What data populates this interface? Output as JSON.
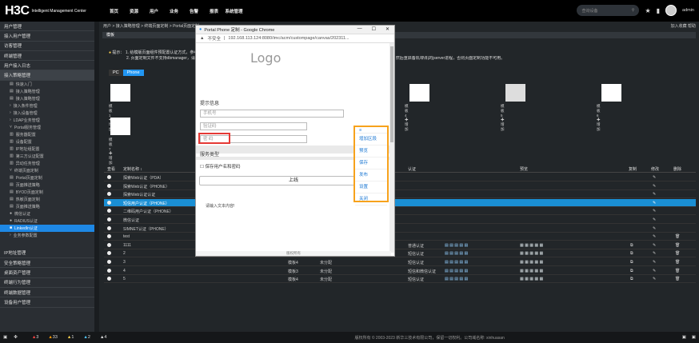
{
  "app": {
    "logo_main": "H3C",
    "logo_sub": "Intelligent Management Center",
    "menu": [
      "首页",
      "资源",
      "用户",
      "业务",
      "告警",
      "报表",
      "系统管理"
    ],
    "search_placeholder": "查询设备",
    "user": "admin"
  },
  "sidebar": {
    "items": [
      {
        "label": "用户管理"
      },
      {
        "label": "接入用户管理"
      },
      {
        "label": "访客管理"
      },
      {
        "label": "终端管理"
      },
      {
        "label": "用户接入日志"
      },
      {
        "label": "接入策略管理"
      }
    ],
    "subs": [
      {
        "label": "快速入门"
      },
      {
        "label": "接入策略管理"
      },
      {
        "label": "接入策略管理"
      },
      {
        "label": "接入条件管理"
      },
      {
        "label": "接入设备管理"
      },
      {
        "label": "LDAP业务管理"
      },
      {
        "label": "Portal服务管理"
      },
      {
        "label": "服务器配置"
      },
      {
        "label": "设备配置"
      },
      {
        "label": "IP地址组配置"
      },
      {
        "label": "第三方认证配置"
      },
      {
        "label": "异动任务管理"
      },
      {
        "label": "终端页面定制"
      },
      {
        "label": "Portal页面定制"
      },
      {
        "label": "页面推送策略"
      },
      {
        "label": "BYOD页面定制"
      },
      {
        "label": "热敏页面定制"
      },
      {
        "label": "页面推送策略"
      },
      {
        "label": "微信认证"
      },
      {
        "label": "RADIUS认证"
      },
      {
        "label": "LinkedIn认证"
      },
      {
        "label": "业务参数配置"
      }
    ],
    "bottom_items": [
      {
        "label": "IP地址管理"
      },
      {
        "label": "安全策略管理"
      },
      {
        "label": "桌面资产管理"
      },
      {
        "label": "终端行为管理"
      },
      {
        "label": "终端数据管理"
      },
      {
        "label": "设备用户管理"
      }
    ]
  },
  "main": {
    "breadcrumb": "用户 > 接入策略管理 > 终端页面定制 > Portal页面定制",
    "favorites": "加入收藏 帮助",
    "panel_title": "模板",
    "tip_label": "提示：",
    "tip_line1": "1. 给模版页面组件预配置认证方式，参考用户管理员配置说明，对应的方式才能使用。",
    "tip_line2": "2. 页面定制文件不支持dbmanager，请将定制文件在imc\\client\\web\\apps\\imc\\acm\\custompage\\canvas目录下的所有文件拷贝到备机/新机的相应目录下，然后重启备机/新机的jserver进程，否则页面定制功能不可用。",
    "tabs": [
      "PC",
      "Phone"
    ],
    "thumbs": [
      {
        "label": "模板1"
      },
      {
        "label": "模板7"
      },
      {
        "label": "模板4"
      },
      {
        "label": "模板5"
      },
      {
        "label": "模板6"
      }
    ],
    "add_label": "增加",
    "columns": [
      "查看",
      "定制名称 ↕",
      "终端",
      "状态",
      "认证",
      "预览",
      "复制",
      "修改",
      "删除"
    ],
    "rows": [
      {
        "name": "探索Web认证（PDA）",
        "type": "",
        "state": "",
        "auth": "",
        "selected": false
      },
      {
        "name": "探索Web认证（PHONE）",
        "type": "",
        "state": "",
        "auth": "",
        "selected": false
      },
      {
        "name": "探索Web认证认证",
        "type": "",
        "state": "",
        "auth": "",
        "selected": false
      },
      {
        "name": "短信用户认证（PHONE）",
        "type": "",
        "state": "",
        "auth": "",
        "selected": true
      },
      {
        "name": "二维码用户认证（PHONE）",
        "type": "",
        "state": "",
        "auth": "",
        "selected": false
      },
      {
        "name": "微信认证",
        "type": "",
        "state": "",
        "auth": "",
        "selected": false
      },
      {
        "name": "SIMNET认证（PHONE）",
        "type": "",
        "state": "",
        "auth": "",
        "selected": false
      },
      {
        "name": "test",
        "type": "",
        "state": "",
        "auth": "",
        "selected": false
      },
      {
        "name": "1111",
        "type": "模板1",
        "state": "未分配",
        "auth": "普通认证",
        "selected": false
      },
      {
        "name": "2",
        "type": "模板1",
        "state": "未分配",
        "auth": "短信认证",
        "selected": false
      },
      {
        "name": "3",
        "type": "模板4",
        "state": "未分配",
        "auth": "短信认证",
        "selected": false
      },
      {
        "name": "4",
        "type": "模板3",
        "state": "未分配",
        "auth": "短信和微信认证",
        "selected": false
      },
      {
        "name": "5",
        "type": "模板4",
        "state": "未分配",
        "auth": "短信认证",
        "selected": false
      }
    ]
  },
  "popup": {
    "title": "Portal Phone 定制 - Google Chrome",
    "security": "不安全",
    "address": "192.168.113.124:8080/imc/acm/custompage/canvas/202311...",
    "logo": "Logo",
    "section_info": "提示信息",
    "phone_ph": "手机号",
    "code_ph": "验证码",
    "pwd_ph": "密 码",
    "service_type": "服务类型",
    "save_pwd": "保存用户名和密码",
    "login": "上线",
    "note": "请输入文本内容!",
    "footer": "版权所有"
  },
  "context_menu": [
    "增加区段",
    "预览",
    "保存",
    "发布",
    "设置",
    "关闭"
  ],
  "footer": {
    "alarms": [
      "3",
      "33",
      "1",
      "2",
      "4"
    ],
    "copyright": "版权所有 © 2003-2023 新华三技术有限公司，保留一切权利。公司域名称: xinhuasan",
    "ime": "计算器"
  },
  "colors": {
    "accent": "#1e88e5",
    "orange": "#f7a21c",
    "red": "#e53935"
  }
}
